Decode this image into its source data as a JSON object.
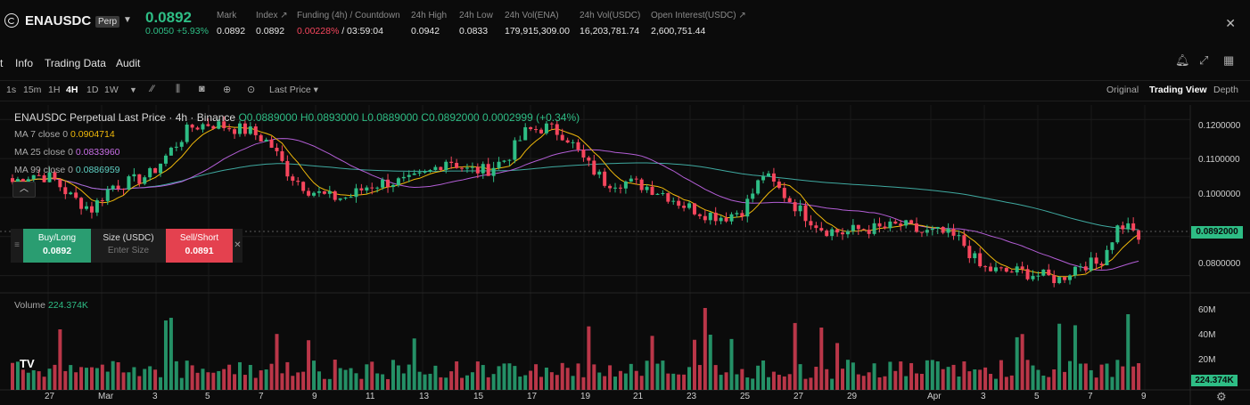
{
  "ticker": {
    "symbol": "ENAUSDC",
    "badge": "Perp",
    "price": "0.0892",
    "change": "0.0050 +5.93%",
    "stats": [
      {
        "label": "Mark",
        "value": "0.0892"
      },
      {
        "label": "Index ↗",
        "value": "0.0892"
      },
      {
        "label": "Funding (4h) / Countdown",
        "value_funding": "0.00228%",
        "value_countdown": "/ 03:59:04"
      },
      {
        "label": "24h High",
        "value": "0.0942"
      },
      {
        "label": "24h Low",
        "value": "0.0833"
      },
      {
        "label": "24h Vol(ENA)",
        "value": "179,915,309.00"
      },
      {
        "label": "24h Vol(USDC)",
        "value": "16,203,781.74"
      },
      {
        "label": "Open Interest(USDC) ↗",
        "value": "2,600,751.44"
      }
    ]
  },
  "tabs": [
    "t",
    "Info",
    "Trading Data",
    "Audit"
  ],
  "intervals": [
    "1s",
    "15m",
    "1H",
    "4H",
    "1D",
    "1W"
  ],
  "active_interval": "4H",
  "price_type": "Last Price",
  "views": [
    "Original",
    "Trading View",
    "Depth"
  ],
  "active_view": "Trading View",
  "legend": {
    "title": "ENAUSDC Perpetual Last Price · 4h · Binance",
    "ohlc": "O0.0889000 H0.0893000 L0.0889000 C0.0892000 0.0002999 (+0.34%)",
    "ma7_label": "MA 7 close 0",
    "ma7_value": "0.0904714",
    "ma25_label": "MA 25 close 0",
    "ma25_value": "0.0833960",
    "ma99_label": "MA 99 close 0",
    "ma99_value": "0.0886959",
    "volume_label": "Volume",
    "volume_value": "224.374K"
  },
  "trade_widget": {
    "buy_label": "Buy/Long",
    "buy_price": "0.0892",
    "size_label": "Size (USDC)",
    "size_placeholder": "Enter Size",
    "sell_label": "Sell/Short",
    "sell_price": "0.0891"
  },
  "colors": {
    "up": "#2ebd85",
    "down": "#f6465d",
    "ma7": "#f0b90b",
    "ma25": "#b35ed6",
    "ma99": "#3fa9a0"
  },
  "chart_data": {
    "type": "candlestick",
    "title": "ENAUSDC Perpetual Last Price · 4h · Binance",
    "y_ticks": [
      "0.1200000",
      "0.1100000",
      "0.1000000",
      "0.0800000"
    ],
    "current_price_label": "0.0892000",
    "ylim": [
      0.0758,
      0.1237
    ],
    "x_ticks": [
      "27",
      "Mar",
      "3",
      "5",
      "7",
      "9",
      "11",
      "13",
      "15",
      "17",
      "19",
      "21",
      "23",
      "25",
      "27",
      "29",
      "Apr",
      "3",
      "5",
      "7",
      "9"
    ],
    "volume_ticks": [
      "60M",
      "40M",
      "20M"
    ],
    "current_volume_label": "224.374K",
    "close_path": [
      0.104,
      0.106,
      0.105,
      0.1,
      0.097,
      0.103,
      0.104,
      0.106,
      0.112,
      0.118,
      0.119,
      0.118,
      0.117,
      0.114,
      0.106,
      0.102,
      0.1,
      0.1,
      0.103,
      0.104,
      0.104,
      0.106,
      0.11,
      0.107,
      0.107,
      0.11,
      0.117,
      0.118,
      0.116,
      0.109,
      0.104,
      0.104,
      0.103,
      0.101,
      0.098,
      0.096,
      0.095,
      0.097,
      0.106,
      0.101,
      0.096,
      0.092,
      0.091,
      0.092,
      0.092,
      0.093,
      0.091,
      0.091,
      0.089,
      0.082,
      0.081,
      0.081,
      0.08,
      0.079,
      0.083,
      0.083,
      0.093,
      0.092
    ]
  }
}
